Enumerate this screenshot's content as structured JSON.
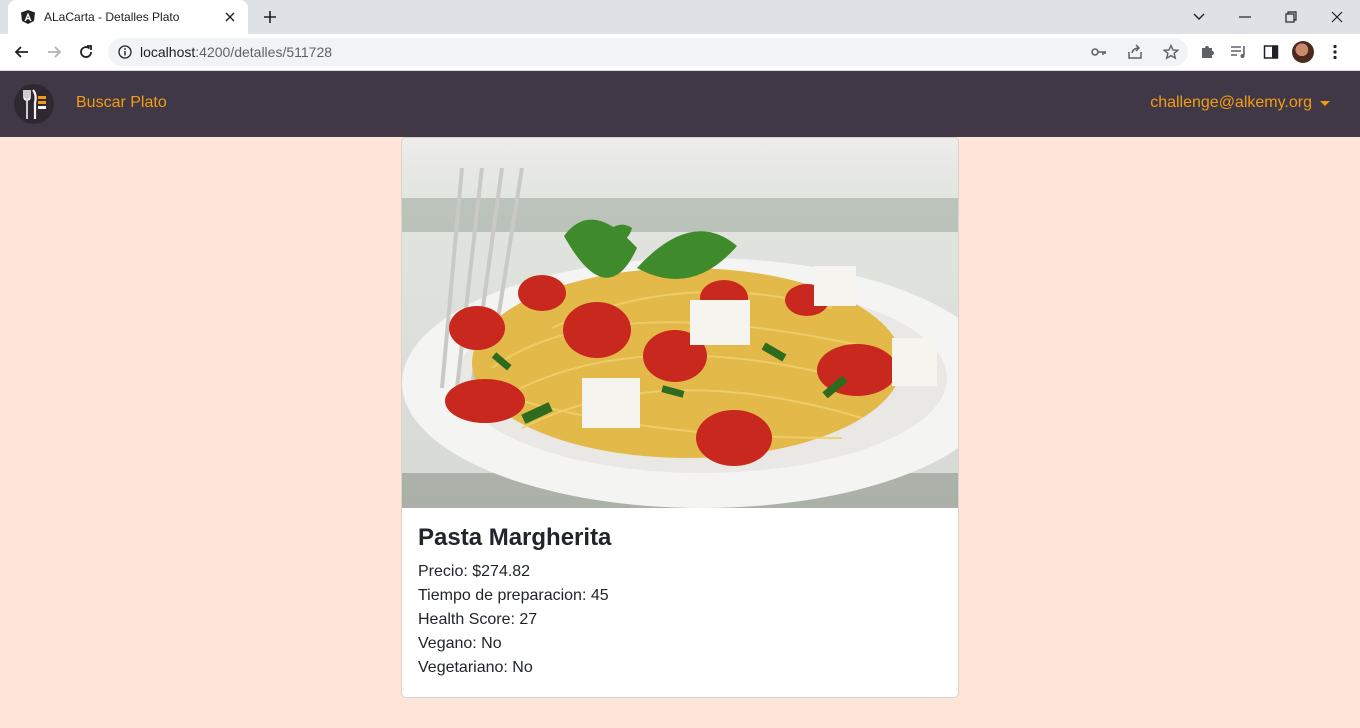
{
  "browser": {
    "tab_title": "ALaCarta - Detalles Plato",
    "url_host": "localhost",
    "url_rest": ":4200/detalles/511728"
  },
  "navbar": {
    "link_buscar": "Buscar Plato",
    "user_email": "challenge@alkemy.org"
  },
  "dish": {
    "title": "Pasta Margherita",
    "precio": "Precio: $274.82",
    "tiempo": "Tiempo de preparacion: 45",
    "health": "Health Score: 27",
    "vegano": "Vegano: No",
    "vegetariano": "Vegetariano: No"
  },
  "colors": {
    "page_bg": "#ffe4da",
    "navbar_bg": "#413847",
    "accent": "#f39c12"
  },
  "icons": {
    "tab_favicon": "angular-icon",
    "brand": "cutlery-logo-icon"
  }
}
